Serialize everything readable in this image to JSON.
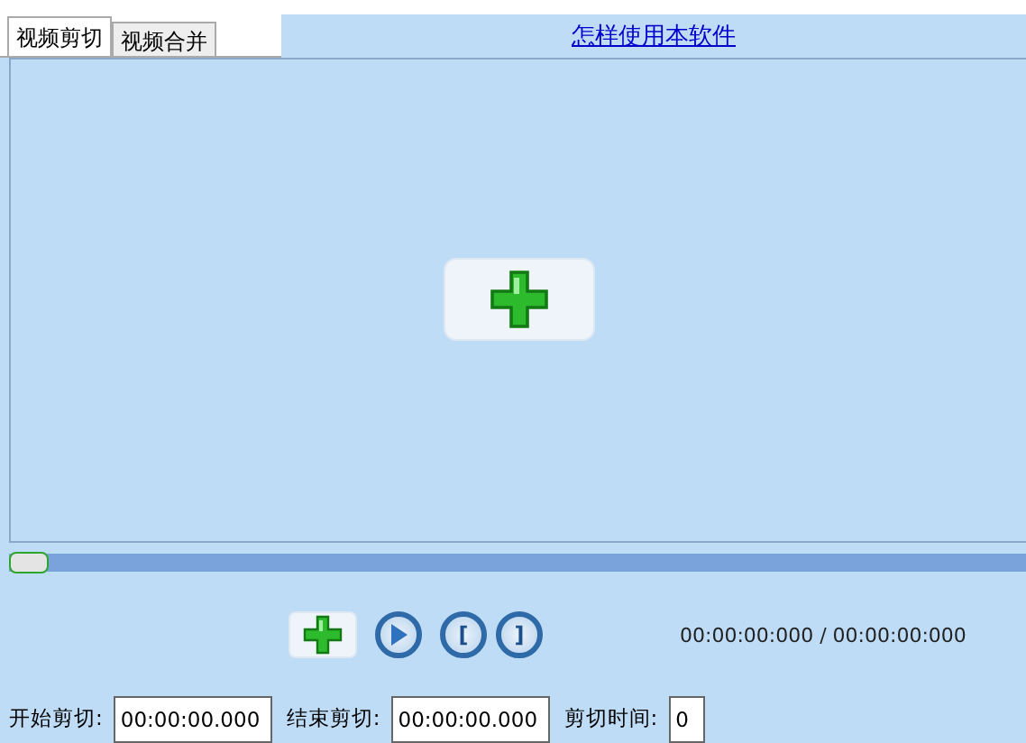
{
  "tabs": [
    {
      "label": "视频剪切",
      "selected": true
    },
    {
      "label": "视频合并",
      "selected": false
    }
  ],
  "help_link": "怎样使用本软件",
  "timeline": {
    "level": 0
  },
  "controls": [
    {
      "kind": "add"
    },
    {
      "kind": "play"
    },
    {
      "kind": "mark_in",
      "label": "["
    },
    {
      "kind": "mark_out",
      "label": "]"
    }
  ],
  "time_display": "00:00:00:000 / 00:00:00:000",
  "cut_fields": [
    {
      "label": "开始剪切:",
      "value": "00:00:00.000"
    },
    {
      "label": "结束剪切:",
      "value": "00:00:00.000"
    },
    {
      "label": "剪切时间:",
      "value": "0"
    }
  ]
}
